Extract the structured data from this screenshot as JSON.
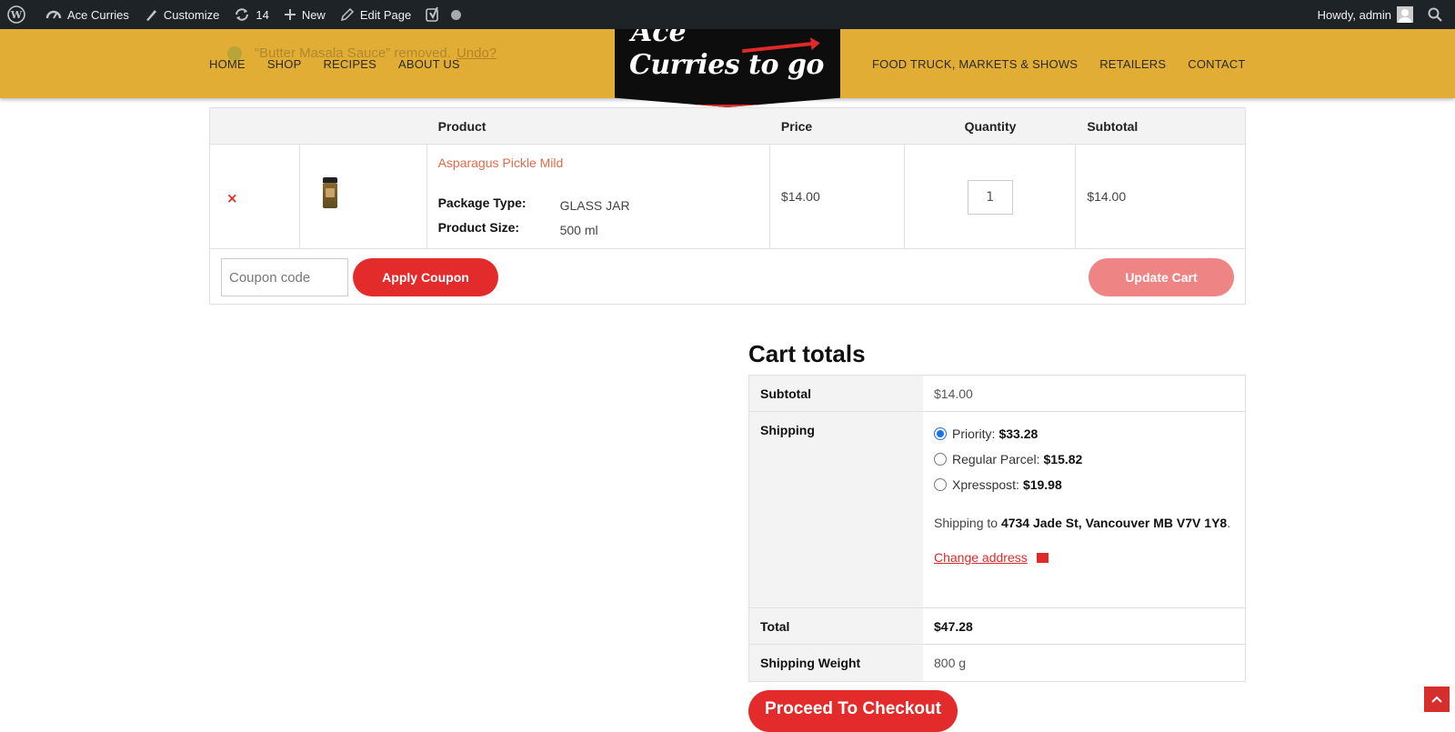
{
  "adminbar": {
    "site_name": "Ace Curries",
    "customize": "Customize",
    "updates_count": "14",
    "new_label": "New",
    "edit_page": "Edit Page",
    "howdy": "Howdy, admin"
  },
  "notice": {
    "text": "“Butter Masala Sauce” removed.",
    "undo": "Undo?"
  },
  "nav": {
    "left": [
      "HOME",
      "SHOP",
      "RECIPES",
      "ABOUT US"
    ],
    "right": [
      "FOOD TRUCK, MARKETS & SHOWS",
      "RETAILERS",
      "CONTACT"
    ]
  },
  "logo": {
    "top_text": "Ace",
    "main_text": "Curries",
    "to_go": "to go"
  },
  "cart": {
    "headers": {
      "product": "Product",
      "price": "Price",
      "quantity": "Quantity",
      "subtotal": "Subtotal"
    },
    "item": {
      "remove": "×",
      "name": "Asparagus Pickle Mild",
      "package_type_label": "Package Type:",
      "package_type_value": "GLASS JAR",
      "product_size_label": "Product Size:",
      "product_size_value": "500 ml",
      "price": "$14.00",
      "quantity": "1",
      "subtotal": "$14.00"
    },
    "coupon_placeholder": "Coupon code",
    "apply_coupon": "Apply Coupon",
    "update_cart": "Update Cart"
  },
  "totals": {
    "title": "Cart totals",
    "subtotal_label": "Subtotal",
    "subtotal_value": "$14.00",
    "shipping_label": "Shipping",
    "options": [
      {
        "name": "Priority:",
        "price": "$33.28",
        "selected": true
      },
      {
        "name": "Regular Parcel:",
        "price": "$15.82",
        "selected": false
      },
      {
        "name": "Xpresspost:",
        "price": "$19.98",
        "selected": false
      }
    ],
    "shipping_to_prefix": "Shipping to",
    "shipping_address": "4734 Jade St, Vancouver MB V7V 1Y8",
    "change_address": "Change address",
    "total_label": "Total",
    "total_value": "$47.28",
    "weight_label": "Shipping Weight",
    "weight_value": "800 g"
  },
  "checkout": "Proceed To Checkout",
  "colors": {
    "accent": "#e32b2b",
    "header": "#e1ad35",
    "adminbar": "#1d2327"
  }
}
